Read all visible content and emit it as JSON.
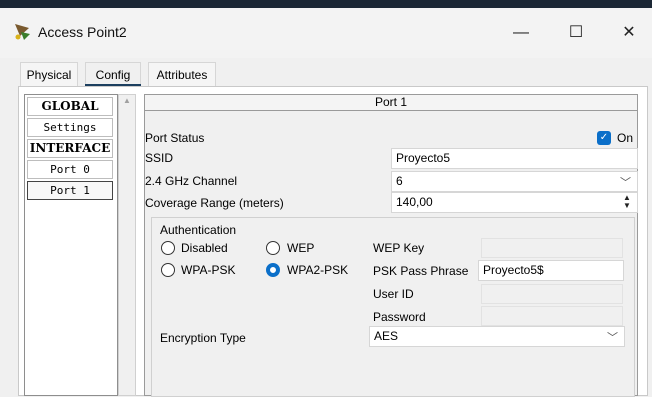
{
  "window": {
    "title": "Access Point2",
    "icon": "router-icon",
    "minimize_glyph": "—",
    "maximize_glyph": "☐",
    "close_glyph": "✕"
  },
  "tabs": [
    {
      "label": "Physical"
    },
    {
      "label": "Config"
    },
    {
      "label": "Attributes"
    }
  ],
  "sidebar": {
    "items": [
      {
        "label": "GLOBAL"
      },
      {
        "label": "Settings"
      },
      {
        "label": "INTERFACE"
      },
      {
        "label": "Port 0"
      },
      {
        "label": "Port 1"
      }
    ],
    "selected": "Port 1"
  },
  "port": {
    "header": "Port 1",
    "port_status_label": "Port Status",
    "port_status_on_label": "On",
    "port_status_checked": true,
    "ssid_label": "SSID",
    "ssid_value": "Proyecto5",
    "channel_label": "2.4 GHz Channel",
    "channel_value": "6",
    "coverage_label": "Coverage Range (meters)",
    "coverage_value": "140,00"
  },
  "auth": {
    "title": "Authentication",
    "options": [
      {
        "label": "Disabled",
        "checked": false
      },
      {
        "label": "WEP",
        "checked": false
      },
      {
        "label": "WPA-PSK",
        "checked": false
      },
      {
        "label": "WPA2-PSK",
        "checked": true
      }
    ],
    "wep_key_label": "WEP Key",
    "psk_label": "PSK Pass Phrase",
    "psk_value": "Proyecto5$",
    "user_id_label": "User ID",
    "password_label": "Password",
    "encryption_label": "Encryption Type",
    "encryption_value": "AES"
  },
  "glyphs": {
    "chevron": "﹀",
    "check": "✓",
    "scroll_up": "▲",
    "spin_up": "▲",
    "spin_down": "▼"
  }
}
